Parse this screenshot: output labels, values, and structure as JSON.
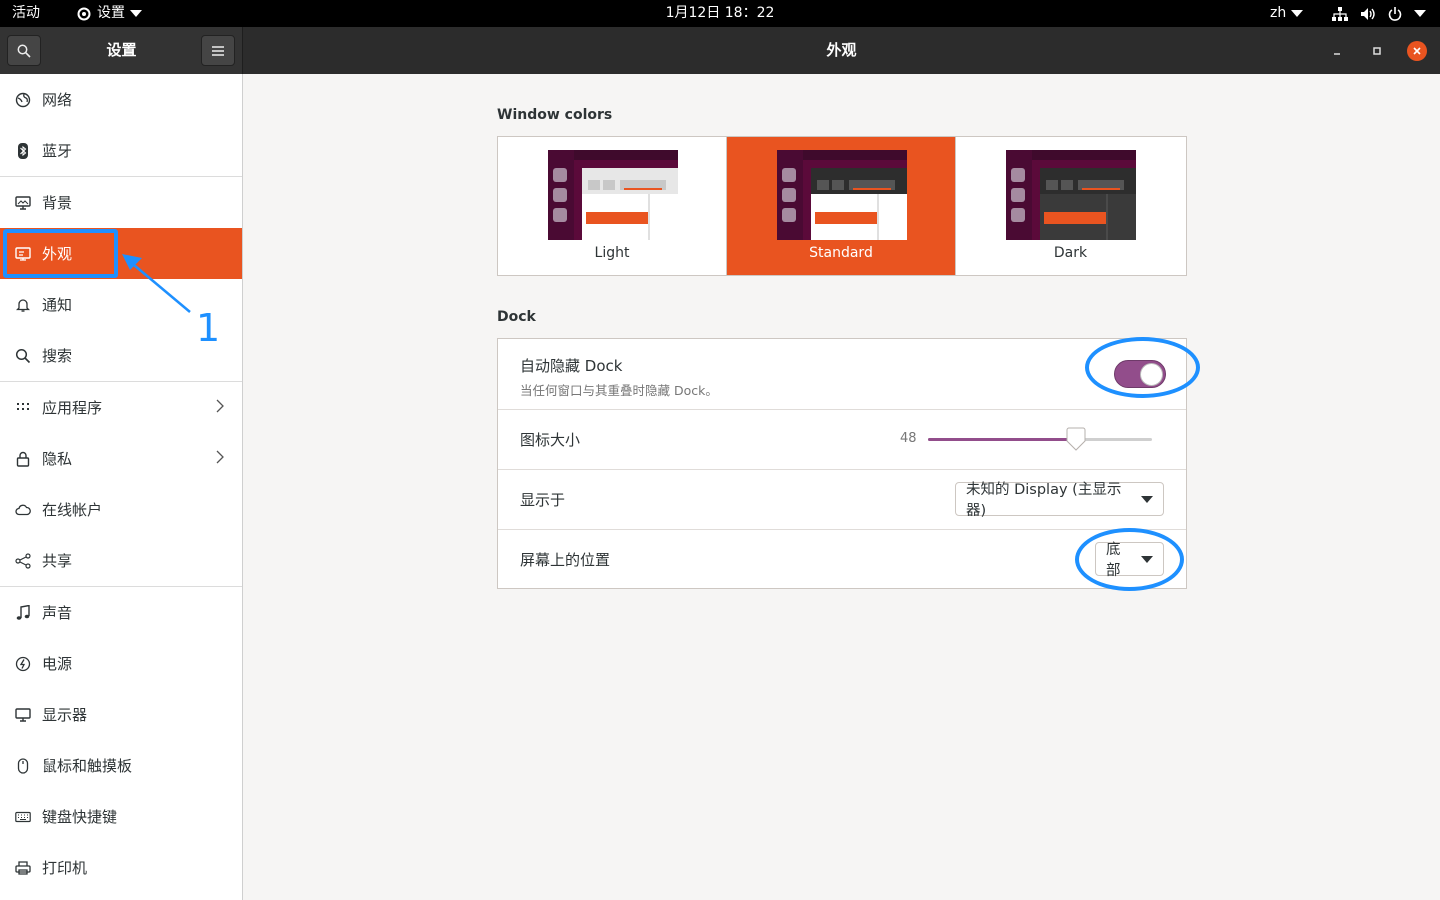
{
  "topbar": {
    "activities": "活动",
    "app_menu": "设置",
    "clock": "1月12日  18：22",
    "lang": "zh"
  },
  "headerbar": {
    "sidebar_title": "设置",
    "title": "外观"
  },
  "sidebar": {
    "items": [
      {
        "label": "网络",
        "icon": "network-icon"
      },
      {
        "label": "蓝牙",
        "icon": "bluetooth-icon"
      },
      {
        "label": "背景",
        "icon": "background-icon"
      },
      {
        "label": "外观",
        "icon": "appearance-icon"
      },
      {
        "label": "通知",
        "icon": "bell-icon"
      },
      {
        "label": "搜索",
        "icon": "search-icon"
      },
      {
        "label": "应用程序",
        "icon": "apps-grid-icon"
      },
      {
        "label": "隐私",
        "icon": "lock-icon"
      },
      {
        "label": "在线帐户",
        "icon": "cloud-icon"
      },
      {
        "label": "共享",
        "icon": "share-icon"
      },
      {
        "label": "声音",
        "icon": "music-note-icon"
      },
      {
        "label": "电源",
        "icon": "power-icon"
      },
      {
        "label": "显示器",
        "icon": "display-icon"
      },
      {
        "label": "鼠标和触摸板",
        "icon": "mouse-icon"
      },
      {
        "label": "键盘快捷键",
        "icon": "keyboard-icon"
      },
      {
        "label": "打印机",
        "icon": "printer-icon"
      }
    ],
    "active_index": 3
  },
  "window_colors": {
    "title": "Window colors",
    "options": [
      "Light",
      "Standard",
      "Dark"
    ],
    "selected": "Standard"
  },
  "dock": {
    "title": "Dock",
    "autohide_label": "自动隐藏 Dock",
    "autohide_desc": "当任何窗口与其重叠时隐藏 Dock。",
    "autohide_on": true,
    "icon_size_label": "图标大小",
    "icon_size_value": "48",
    "icon_size_fraction": 0.66,
    "show_on_label": "显示于",
    "show_on_value": "未知的 Display (主显示器)",
    "position_label": "屏幕上的位置",
    "position_value": "底部"
  },
  "annotations": {
    "step_number": "1",
    "color": "#1e90ff"
  },
  "colors": {
    "accent": "#e95420",
    "switch_purple": "#924d8b"
  }
}
